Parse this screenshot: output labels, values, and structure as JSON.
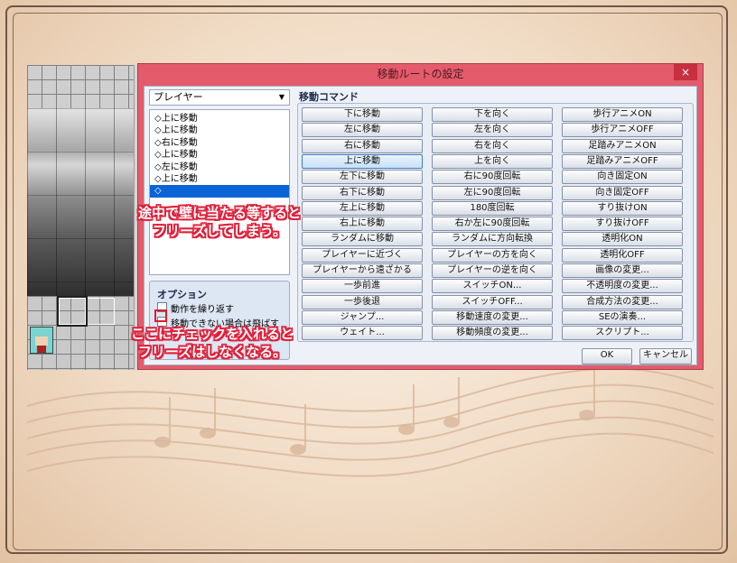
{
  "dialog": {
    "title": "移動ルートの設定",
    "close_label": "×",
    "target": "プレイヤー",
    "target_arrow": "▼",
    "list_items": [
      "◇上に移動",
      "◇上に移動",
      "◇右に移動",
      "◇上に移動",
      "◇左に移動",
      "◇上に移動",
      "◇"
    ],
    "options": {
      "title": "オプション",
      "repeat_label": "動作を繰り返す",
      "skip_label": "移動できない場合は飛ばす",
      "repeat_checked": false,
      "skip_checked": false
    },
    "command_title": "移動コマンド",
    "commands_col1": [
      "下に移動",
      "左に移動",
      "右に移動",
      "上に移動",
      "左下に移動",
      "右下に移動",
      "左上に移動",
      "右上に移動",
      "ランダムに移動",
      "プレイヤーに近づく",
      "プレイヤーから遠ざかる",
      "一歩前進",
      "一歩後退",
      "ジャンプ...",
      "ウェイト..."
    ],
    "commands_col2": [
      "下を向く",
      "左を向く",
      "右を向く",
      "上を向く",
      "右に90度回転",
      "左に90度回転",
      "180度回転",
      "右か左に90度回転",
      "ランダムに方向転換",
      "プレイヤーの方を向く",
      "プレイヤーの逆を向く",
      "スイッチON...",
      "スイッチOFF...",
      "移動速度の変更...",
      "移動頻度の変更..."
    ],
    "commands_col3": [
      "歩行アニメON",
      "歩行アニメOFF",
      "足踏みアニメON",
      "足踏みアニメOFF",
      "向き固定ON",
      "向き固定OFF",
      "すり抜けON",
      "すり抜けOFF",
      "透明化ON",
      "透明化OFF",
      "画像の変更...",
      "不透明度の変更...",
      "合成方法の変更...",
      "SEの演奏...",
      "スクリプト..."
    ],
    "ok_label": "OK",
    "cancel_label": "キャンセル"
  },
  "annotations": {
    "top_line1": "途中で壁に当たる等すると",
    "top_line2": "フリーズしてしまう。",
    "bottom_line1": "ここにチェックを入れると",
    "bottom_line2": "フリーズはしなくなる。"
  },
  "colors": {
    "accent_red": "#e0203a",
    "dialog_titlebar": "#e45b6b",
    "selection_blue": "#0a64d8"
  }
}
